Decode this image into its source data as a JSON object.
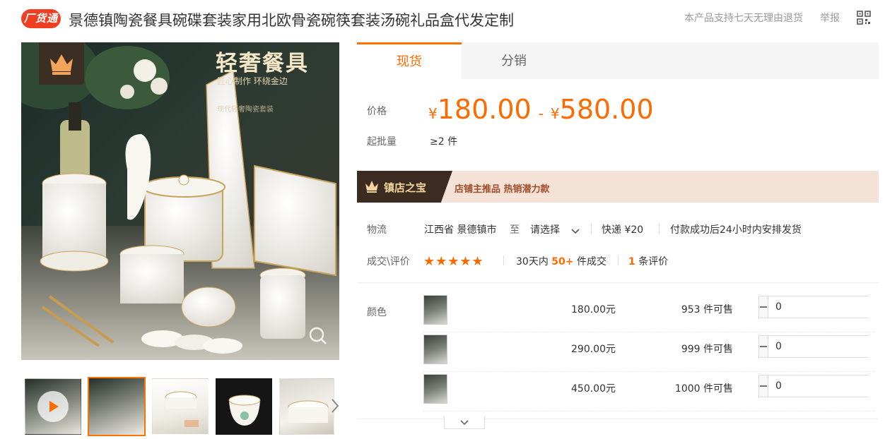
{
  "header": {
    "badge": "厂货通",
    "title": "景德镇陶瓷餐具碗碟套装家用北欧骨瓷碗筷套装汤碗礼品盒代发定制",
    "return_policy": "本产品支持七天无理由退货",
    "report": "举报"
  },
  "gallery": {
    "headline": "轻奢餐具",
    "subline": "匠心制作 环绕金边",
    "subline2": "现代轻奢陶瓷套装",
    "thumbnails": [
      "video",
      "image-1",
      "image-2",
      "image-3",
      "image-4"
    ]
  },
  "tabs": [
    {
      "label": "现货",
      "active": true
    },
    {
      "label": "分销",
      "active": false
    }
  ],
  "price": {
    "label": "价格",
    "currency": "¥",
    "min": "180.00",
    "separator": "-",
    "max": "580.00",
    "min_order_label": "起批量",
    "min_order_value": "≥2 件"
  },
  "banner": {
    "title": "镇店之宝",
    "text": "店铺主推品  热销潜力款"
  },
  "logistics": {
    "label": "物流",
    "origin": "江西省 景德镇市",
    "to": "至",
    "destination": "请选择",
    "shipping": "快递 ¥20",
    "dispatch": "付款成功后24小时内安排发货"
  },
  "reviews": {
    "label": "成交\\评价",
    "stars": "★★★★★",
    "rating": 5,
    "sales_prefix": "30天内",
    "sales_count": "50+",
    "sales_suffix": "件成交",
    "review_count": "1",
    "review_suffix": "条评价"
  },
  "sku": {
    "label": "颜色",
    "rows": [
      {
        "price": "180.00元",
        "stock": "953 件可售",
        "qty": "0"
      },
      {
        "price": "290.00元",
        "stock": "999 件可售",
        "qty": "0"
      },
      {
        "price": "450.00元",
        "stock": "1000 件可售",
        "qty": "0"
      }
    ]
  },
  "colors": {
    "accent": "#ff6a00",
    "badge": "#ee3f22",
    "banner_bg": "#f3e2d5",
    "banner_dark": "#3b2b21"
  }
}
